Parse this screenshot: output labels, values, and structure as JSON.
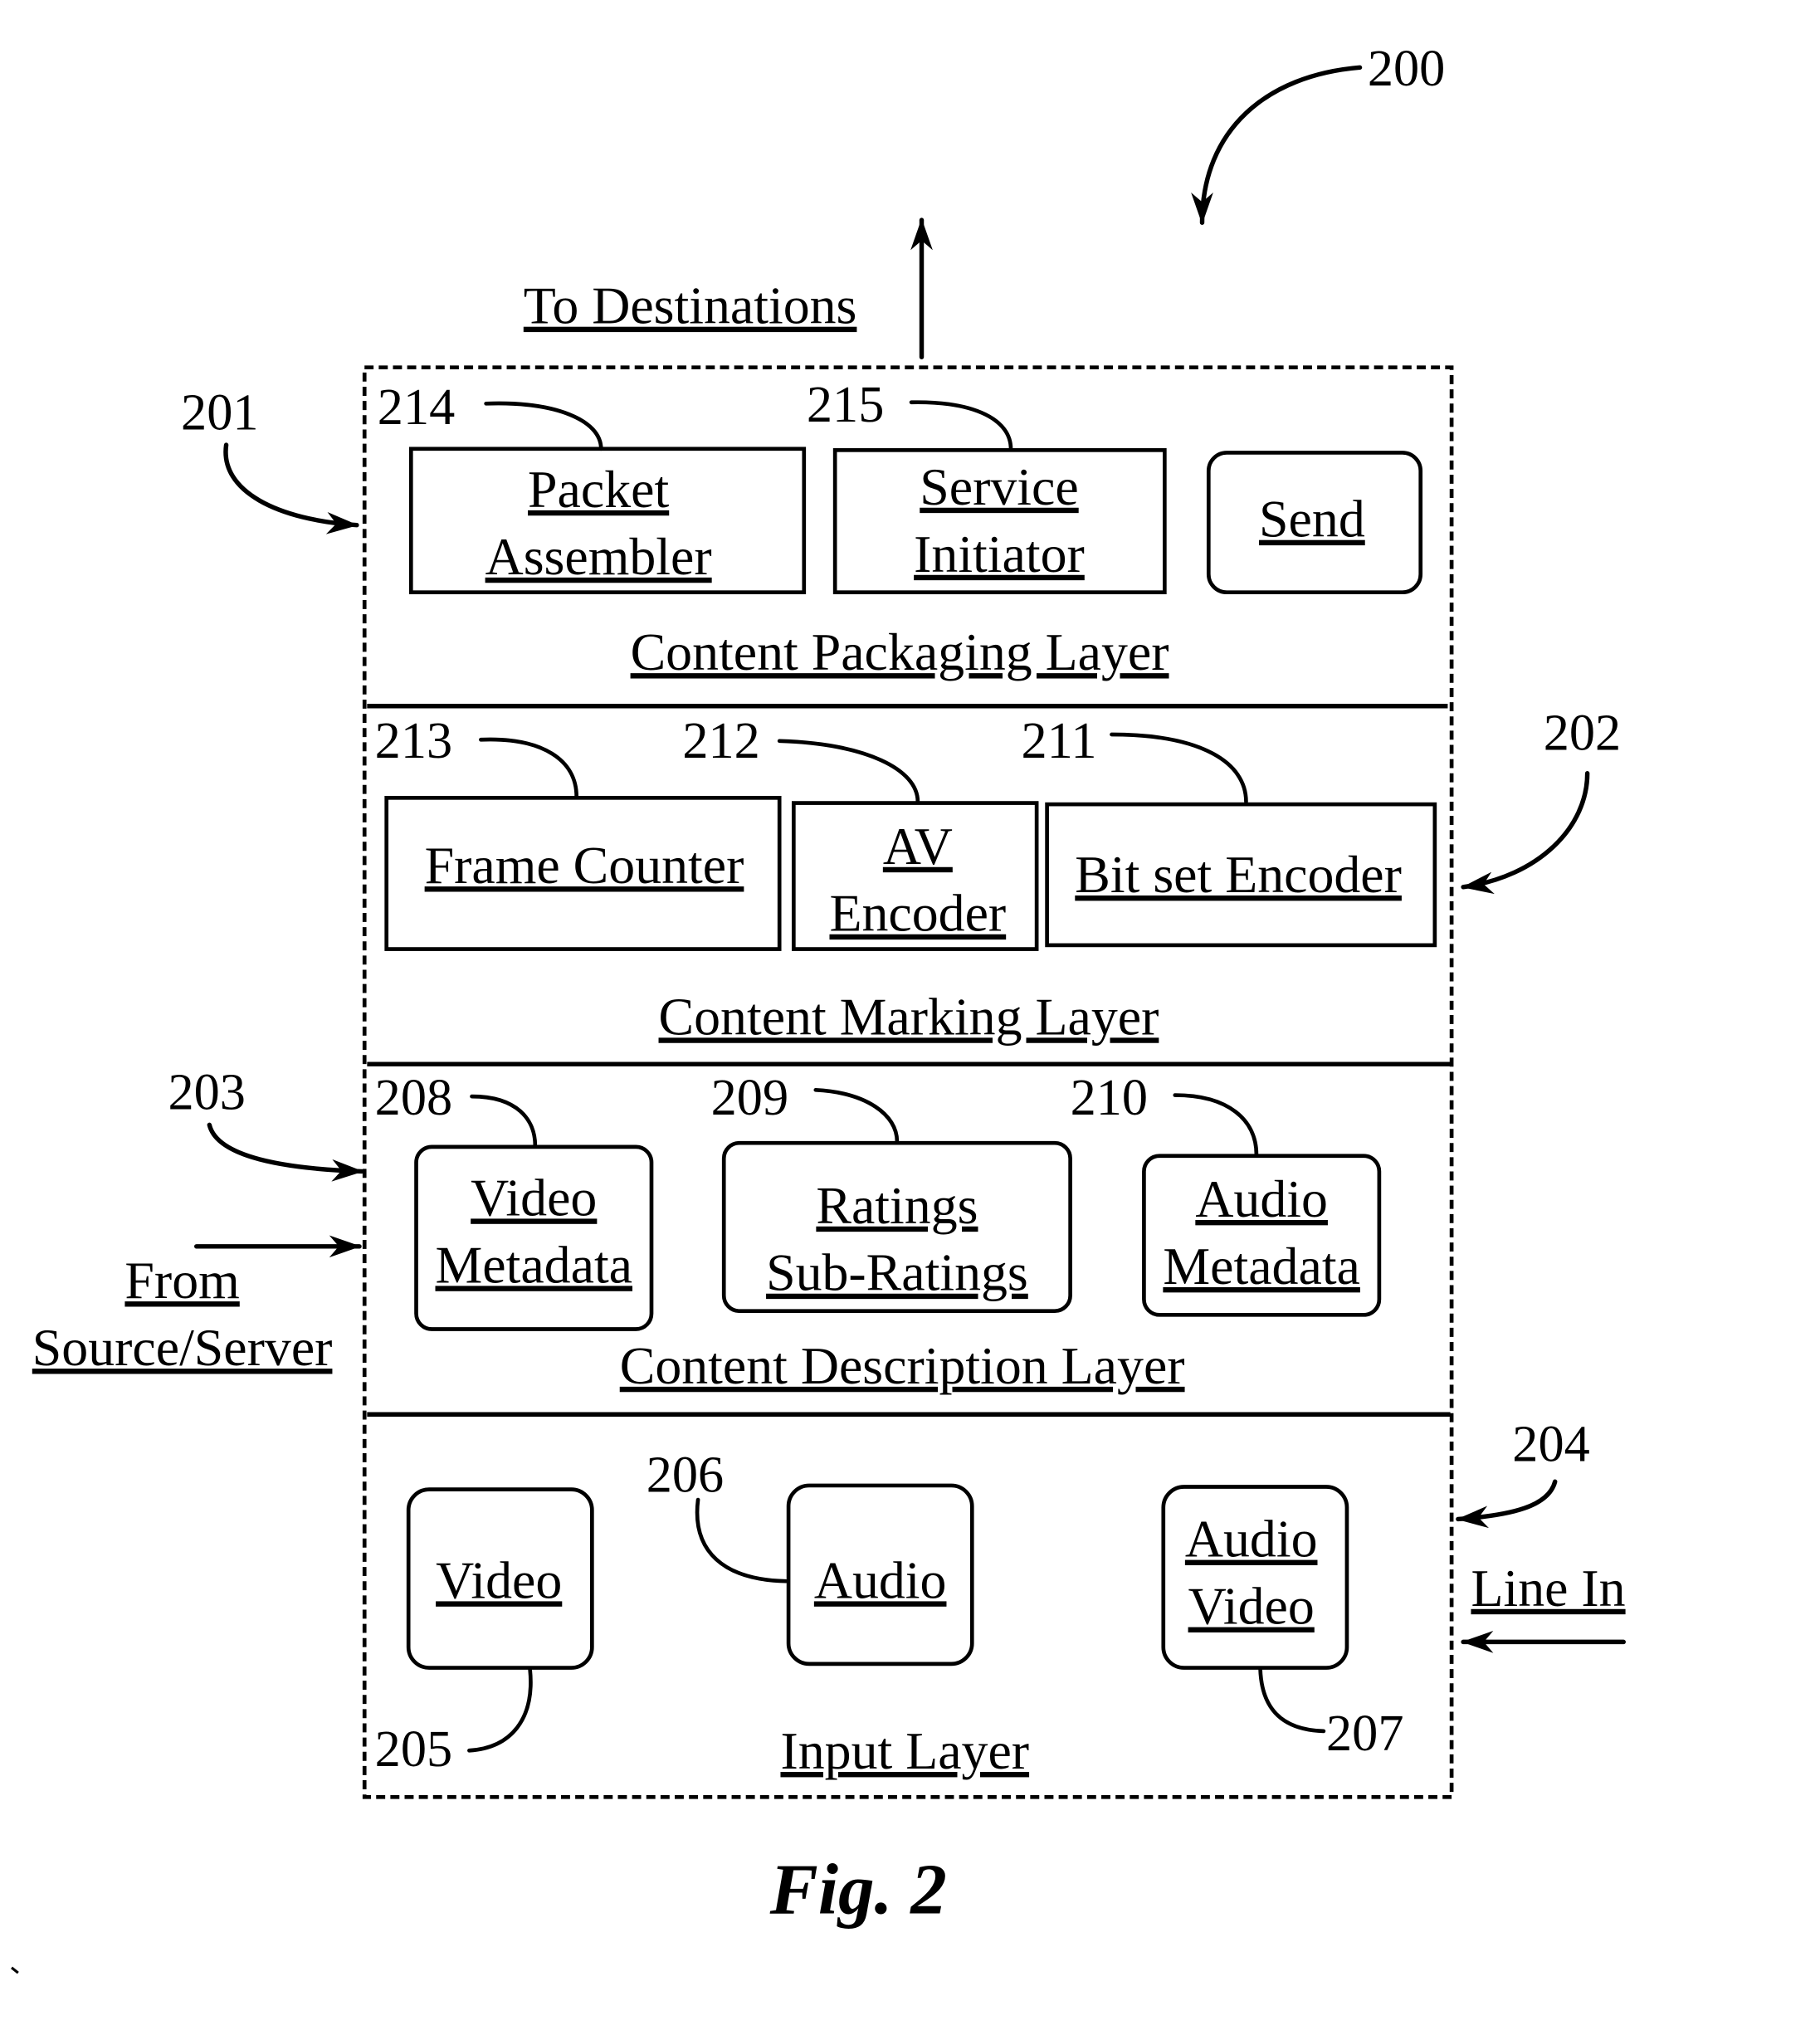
{
  "figure": {
    "caption": "Fig. 2",
    "system_ref": "200"
  },
  "external": {
    "to_destinations": "To Destinations",
    "from_source_line1": "From",
    "from_source_line2": "Source/Server",
    "line_in": "Line In"
  },
  "layers": {
    "packaging": {
      "ref": "201",
      "title": "Content Packaging Layer",
      "components": [
        {
          "ref": "214",
          "line1": "Packet",
          "line2": "Assembler"
        },
        {
          "ref": "215",
          "line1": "Service",
          "line2": "Initiator"
        },
        {
          "ref": "",
          "line1": "Send",
          "line2": ""
        }
      ]
    },
    "marking": {
      "ref": "202",
      "title": "Content Marking Layer",
      "components": [
        {
          "ref": "213",
          "line1": "Frame Counter",
          "line2": ""
        },
        {
          "ref": "212",
          "line1": "AV",
          "line2": "Encoder"
        },
        {
          "ref": "211",
          "line1": "Bit set Encoder",
          "line2": ""
        }
      ]
    },
    "description": {
      "ref": "203",
      "title": "Content Description Layer",
      "components": [
        {
          "ref": "208",
          "line1": "Video",
          "line2": "Metadata"
        },
        {
          "ref": "209",
          "line1": "Ratings",
          "line2": "Sub-Ratings"
        },
        {
          "ref": "210",
          "line1": "Audio",
          "line2": "Metadata"
        }
      ]
    },
    "input": {
      "ref": "204",
      "title": "Input Layer",
      "components": [
        {
          "ref": "205",
          "line1": "Video",
          "line2": ""
        },
        {
          "ref": "206",
          "line1": "Audio",
          "line2": ""
        },
        {
          "ref": "207",
          "line1": "Audio",
          "line2": "Video"
        }
      ]
    }
  }
}
